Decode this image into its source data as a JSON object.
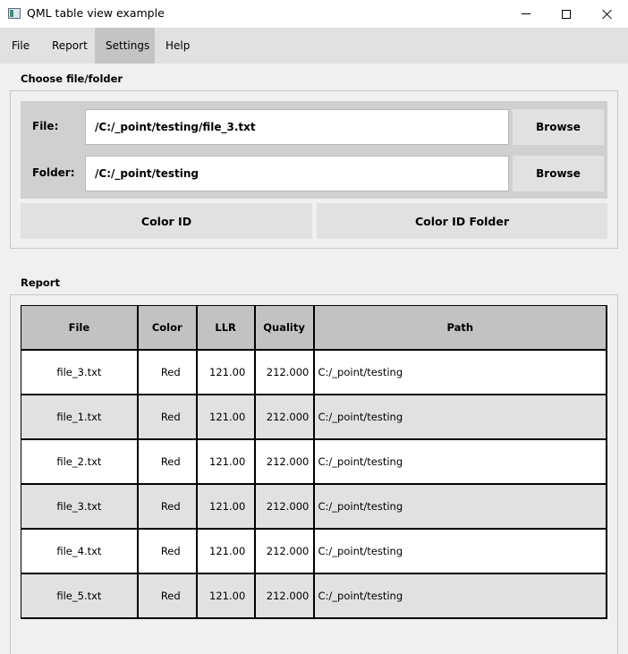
{
  "window": {
    "title": "QML table view example"
  },
  "menu": {
    "items": [
      {
        "label": "File",
        "active": false
      },
      {
        "label": "Report",
        "active": false
      },
      {
        "label": "Settings",
        "active": true
      },
      {
        "label": "Help",
        "active": false
      }
    ]
  },
  "choose": {
    "title": "Choose file/folder",
    "file_label": "File:",
    "file_value": "/C:/_point/testing/file_3.txt",
    "folder_label": "Folder:",
    "folder_value": "/C:/_point/testing",
    "browse_label": "Browse",
    "color_id_label": "Color ID",
    "color_id_folder_label": "Color ID Folder"
  },
  "report": {
    "title": "Report",
    "columns": [
      "File",
      "Color",
      "LLR",
      "Quality",
      "Path"
    ],
    "rows": [
      [
        "file_3.txt",
        "Red",
        "121.00",
        "212.000",
        "C:/_point/testing"
      ],
      [
        "file_1.txt",
        "Red",
        "121.00",
        "212.000",
        "C:/_point/testing"
      ],
      [
        "file_2.txt",
        "Red",
        "121.00",
        "212.000",
        "C:/_point/testing"
      ],
      [
        "file_3.txt",
        "Red",
        "121.00",
        "212.000",
        "C:/_point/testing"
      ],
      [
        "file_4.txt",
        "Red",
        "121.00",
        "212.000",
        "C:/_point/testing"
      ],
      [
        "file_5.txt",
        "Red",
        "121.00",
        "212.000",
        "C:/_point/testing"
      ]
    ]
  },
  "colors": {
    "menubar": "#e1e1e1",
    "menu_active": "#c4c4c4",
    "header": "#c2c2c2",
    "row_alt": "#e1e1e1"
  }
}
